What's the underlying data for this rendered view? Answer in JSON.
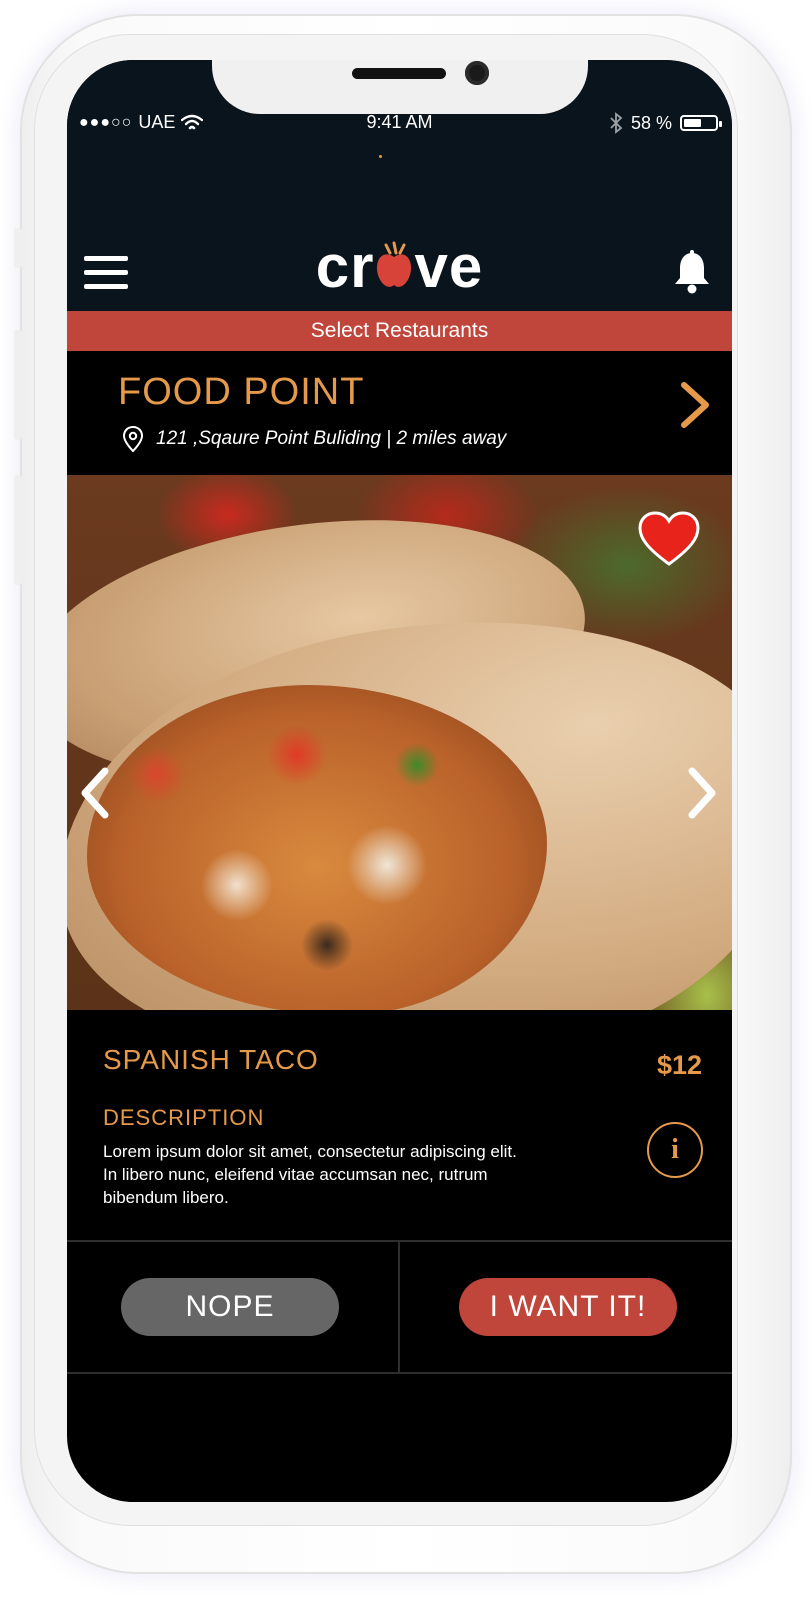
{
  "status_bar": {
    "signal_dots": "●●●○○",
    "carrier": "UAE",
    "time": "9:41 AM",
    "battery_percent": "58 %",
    "battery_level": 0.58
  },
  "header": {
    "logo_text_left": "cr",
    "logo_text_right": "ve",
    "banner": "Select Restaurants"
  },
  "restaurant": {
    "name": "FOOD POINT",
    "address": "121 ,Sqaure Point Buliding | 2 miles away"
  },
  "dish": {
    "name": "SPANISH TACO",
    "price": "$12",
    "description_heading": "DESCRIPTION",
    "description": "Lorem ipsum dolor sit amet, consectetur adipiscing elit. In libero nunc, eleifend vitae accumsan nec, rutrum bibendum libero.",
    "info_label": "i"
  },
  "actions": {
    "nope_label": "NOPE",
    "want_label": "I WANT IT!"
  },
  "colors": {
    "accent_orange": "#e59a4b",
    "brand_red": "#c0453a",
    "header_bg": "#0a141d",
    "heart": "#e8231b"
  },
  "icons": {
    "menu": "hamburger-icon",
    "notifications": "bell-icon",
    "location": "map-pin-icon",
    "next_restaurant": "chevron-right-icon",
    "prev_image": "chevron-left-icon",
    "next_image": "chevron-right-icon",
    "favorite": "heart-icon",
    "info": "info-icon",
    "wifi": "wifi-icon",
    "bluetooth": "bluetooth-icon",
    "battery": "battery-icon"
  }
}
